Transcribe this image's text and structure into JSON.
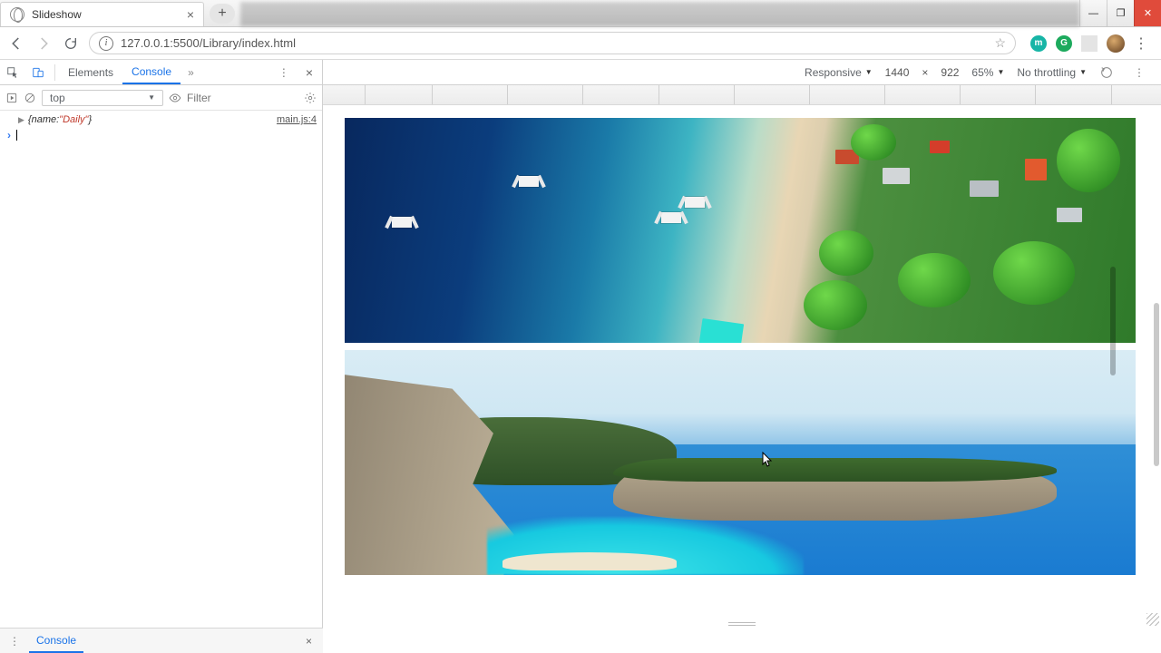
{
  "browser": {
    "tab_title": "Slideshow",
    "url": "127.0.0.1:5500/Library/index.html"
  },
  "devtools": {
    "tabs": {
      "elements": "Elements",
      "console": "Console"
    },
    "device_mode": {
      "device": "Responsive",
      "width": "1440",
      "x": "×",
      "height": "922",
      "zoom": "65%",
      "throttling": "No throttling"
    },
    "console_toolbar": {
      "context": "top",
      "filter_placeholder": "Filter"
    },
    "log": {
      "prefix": "{name: ",
      "value": "\"Daily\"",
      "suffix": "}",
      "source": "main.js:4"
    },
    "drawer_label": "Console"
  }
}
